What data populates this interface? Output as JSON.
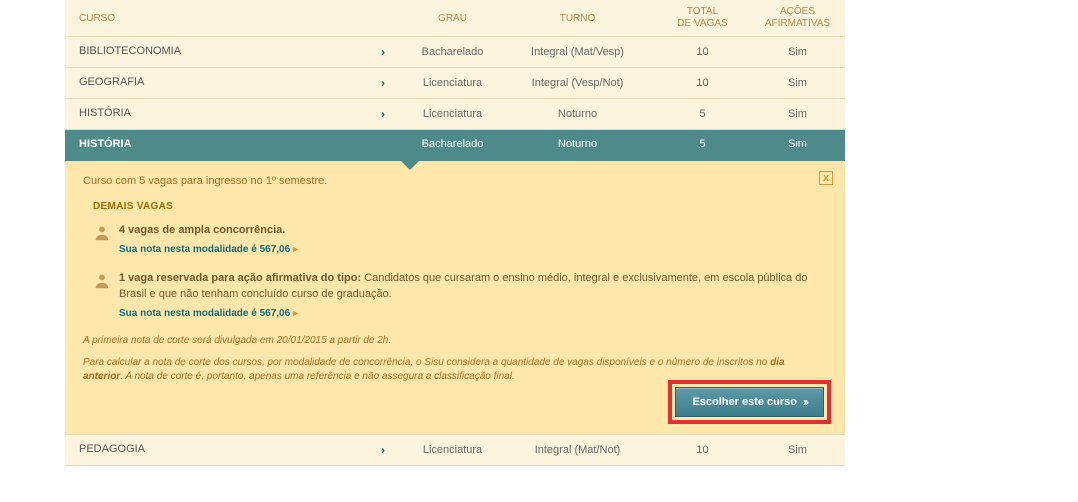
{
  "headers": {
    "curso": "CURSO",
    "grau": "GRAU",
    "turno": "TURNO",
    "totalvagas_l1": "TOTAL",
    "totalvagas_l2": "DE VAGAS",
    "acoes_l1": "AÇÕES",
    "acoes_l2": "AFIRMATIVAS"
  },
  "rows": [
    {
      "curso": "BIBLIOTECONOMIA",
      "grau": "Bacharelado",
      "turno": "Integral (Mat/Vesp)",
      "total": "10",
      "acoes": "Sim",
      "selected": false
    },
    {
      "curso": "GEOGRAFIA",
      "grau": "Licenciatura",
      "turno": "Integral (Vesp/Not)",
      "total": "10",
      "acoes": "Sim",
      "selected": false
    },
    {
      "curso": "HISTÓRIA",
      "grau": "Licenciatura",
      "turno": "Noturno",
      "total": "5",
      "acoes": "Sim",
      "selected": false
    },
    {
      "curso": "HISTÓRIA",
      "grau": "Bacharelado",
      "turno": "Noturno",
      "total": "5",
      "acoes": "Sim",
      "selected": true
    }
  ],
  "rows_after": [
    {
      "curso": "PEDAGOGIA",
      "grau": "Licenciatura",
      "turno": "Integral (Mat/Not)",
      "total": "10",
      "acoes": "Sim",
      "selected": false
    }
  ],
  "detail": {
    "intro": "Curso com 5 vagas para ingresso no 1º semestre.",
    "demais_heading": "DEMAIS VAGAS",
    "item1_strong": "4 vagas de ampla concorrência.",
    "item1_nota": "Sua nota nesta modalidade é 567,06",
    "item2_strong": "1 vaga reservada para ação afirmativa do tipo:",
    "item2_rest": " Candidatos que cursaram o ensino médio, integral e exclusivamente, em escola pública do Brasil e que não tenham concluído curso de graduação.",
    "item2_nota": "Sua nota nesta modalidade é 567,06",
    "fineprint_line1": "A primeira nota de corte será divulgada em 20/01/2015 a partir de 2h.",
    "fineprint_line2a": "Para calcular a nota de corte dos cursos, por modalidade de concorrência, o Sisu considera a quantidade de vagas disponíveis e o número de inscritos no ",
    "fineprint_line2b": "dia anterior",
    "fineprint_line2c": ". A nota de corte é, portanto, apenas uma referência e não assegura a classificação final.",
    "choose_label": "Escolher este curso",
    "close_label": "x"
  }
}
